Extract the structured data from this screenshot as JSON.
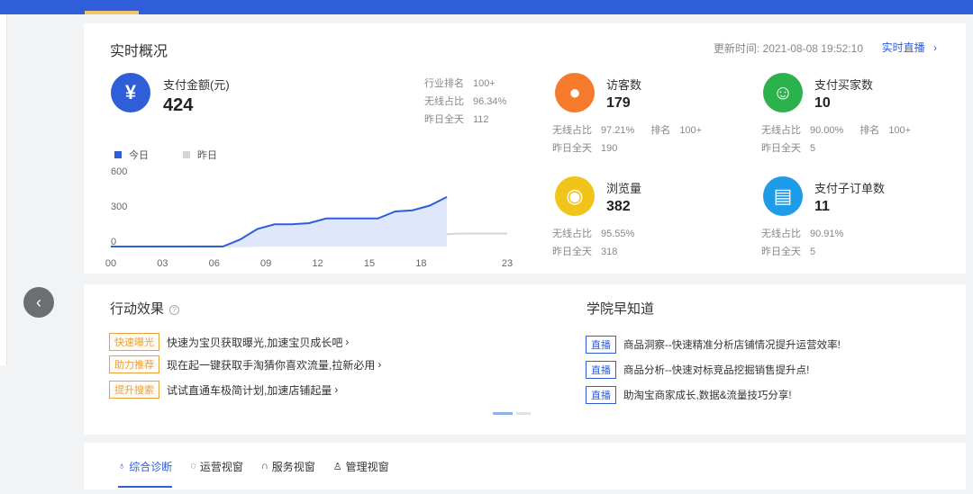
{
  "overview": {
    "title": "实时概况",
    "update_label": "更新时间:",
    "update_time": "2021-08-08 19:52:10",
    "live_link": "实时直播"
  },
  "payment": {
    "icon": "yen-icon",
    "label": "支付金额(元)",
    "value": "424",
    "rank_label": "行业排名",
    "rank_value": "100+",
    "wireless_label": "无线占比",
    "wireless_value": "96.34%",
    "yesterday_label": "昨日全天",
    "yesterday_value": "112"
  },
  "metrics": [
    {
      "icon": "footprint-icon",
      "color": "#f57a2c",
      "label": "访客数",
      "value": "179",
      "wireless_label": "无线占比",
      "wireless_value": "97.21%",
      "rank_label": "排名",
      "rank_value": "100+",
      "yesterday_label": "昨日全天",
      "yesterday_value": "190"
    },
    {
      "icon": "buyers-icon",
      "color": "#2bb24c",
      "label": "支付买家数",
      "value": "10",
      "wireless_label": "无线占比",
      "wireless_value": "90.00%",
      "rank_label": "排名",
      "rank_value": "100+",
      "yesterday_label": "昨日全天",
      "yesterday_value": "5"
    },
    {
      "icon": "eye-icon",
      "color": "#f0c419",
      "label": "浏览量",
      "value": "382",
      "wireless_label": "无线占比",
      "wireless_value": "95.55%",
      "yesterday_label": "昨日全天",
      "yesterday_value": "318"
    },
    {
      "icon": "clipboard-icon",
      "color": "#1f9ce8",
      "label": "支付子订单数",
      "value": "11",
      "wireless_label": "无线占比",
      "wireless_value": "90.91%",
      "yesterday_label": "昨日全天",
      "yesterday_value": "5"
    }
  ],
  "chart_data": {
    "type": "area",
    "x_ticks": [
      "00",
      "03",
      "06",
      "09",
      "12",
      "15",
      "18",
      "23"
    ],
    "y_ticks": [
      "600",
      "300",
      "0"
    ],
    "ylim": [
      0,
      600
    ],
    "xlim": [
      0,
      23
    ],
    "legend": [
      "今日",
      "昨日"
    ],
    "series": [
      {
        "name": "今日",
        "color": "#2f5ed8",
        "x": [
          0,
          6.5,
          7.5,
          8.5,
          9.5,
          10.5,
          11.5,
          12.5,
          13.5,
          14.5,
          15.5,
          16.5,
          17.5,
          18.5,
          19.5
        ],
        "y": [
          0,
          0,
          60,
          150,
          190,
          190,
          200,
          240,
          240,
          240,
          240,
          300,
          310,
          350,
          424
        ]
      },
      {
        "name": "昨日",
        "color": "#d5d5d5",
        "x": [
          0,
          8,
          9,
          10,
          11,
          12,
          13,
          14,
          15,
          16,
          17,
          18,
          19,
          20,
          21,
          22,
          23
        ],
        "y": [
          0,
          5,
          10,
          10,
          10,
          10,
          10,
          10,
          10,
          20,
          40,
          60,
          100,
          110,
          112,
          112,
          112
        ]
      }
    ]
  },
  "action": {
    "title": "行动效果",
    "help_icon": "help-icon",
    "items": [
      {
        "tag": "快速曝光",
        "text": "快速为宝贝获取曝光,加速宝贝成长吧"
      },
      {
        "tag": "助力推荐",
        "text": "现在起一键获取手淘猜你喜欢流量,拉新必用"
      },
      {
        "tag": "提升搜索",
        "text": "试试直通车极简计划,加速店铺起量"
      }
    ]
  },
  "academy": {
    "title": "学院早知道",
    "items": [
      {
        "tag": "直播",
        "text": "商品洞察--快速精准分析店铺情况提升运营效率!"
      },
      {
        "tag": "直播",
        "text": "商品分析--快速对标竞品挖掘销售提升点!"
      },
      {
        "tag": "直播",
        "text": "助淘宝商家成长,数据&流量技巧分享!"
      }
    ]
  },
  "tabs": [
    {
      "icon": "diagnose-icon",
      "label": "综合诊断",
      "active": true
    },
    {
      "icon": "operations-icon",
      "label": "运营视窗"
    },
    {
      "icon": "headset-icon",
      "label": "服务视窗"
    },
    {
      "icon": "manage-icon",
      "label": "管理视窗"
    }
  ]
}
